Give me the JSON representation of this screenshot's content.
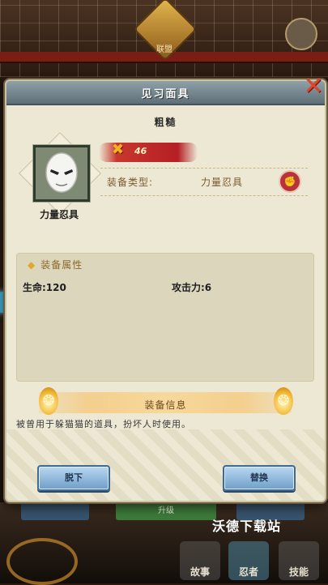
{
  "background": {
    "emblem_label": "联盟",
    "tabs": [
      "",
      "升级",
      ""
    ],
    "nav": [
      {
        "label": "故事",
        "icon": "book-icon"
      },
      {
        "label": "忍者",
        "icon": "ninja-icon"
      },
      {
        "label": "技能",
        "icon": "skill-icon"
      }
    ],
    "watermark": "沃德下载站"
  },
  "dialog": {
    "title": "见习面具",
    "close_icon": "close-x-icon",
    "grade": "粗糙",
    "item": {
      "name": "力量忍具",
      "icon": "white-mask-icon",
      "level": "46",
      "level_icon": "crossed-swords-icon"
    },
    "equip_type_label": "装备类型:",
    "equip_type_value": "力量忍具",
    "equip_type_icon": "fist-icon",
    "attributes": {
      "header": "装备属性",
      "hp": "生命:120",
      "atk": "攻击力:6"
    },
    "info": {
      "title": "装备信息",
      "desc": "被曾用于躲猫猫的道具，扮坏人时使用。"
    },
    "buttons": {
      "unequip": "脱下",
      "replace": "替换"
    }
  },
  "colors": {
    "dialog_bg": "#ece8d3",
    "header_bg": "#6f8089",
    "button_blue": "#7fa9d2",
    "level_red": "#b51f25",
    "close_red": "#e0452a"
  }
}
